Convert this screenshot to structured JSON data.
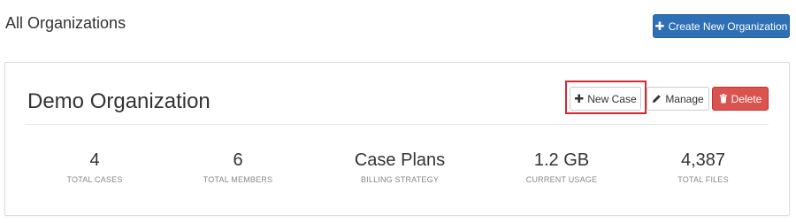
{
  "header": {
    "title": "All Organizations",
    "create_button": {
      "icon": "plus-icon",
      "label": "Create New Organization"
    }
  },
  "organization": {
    "name": "Demo Organization",
    "actions": {
      "new_case": {
        "icon": "plus-icon",
        "label": "New Case"
      },
      "manage": {
        "icon": "pencil-icon",
        "label": "Manage"
      },
      "delete": {
        "icon": "trash-icon",
        "label": "Delete"
      }
    },
    "stats": [
      {
        "value": "4",
        "label": "TOTAL CASES"
      },
      {
        "value": "6",
        "label": "TOTAL MEMBERS"
      },
      {
        "value": "Case Plans",
        "label": "BILLING STRATEGY"
      },
      {
        "value": "1.2 GB",
        "label": "CURRENT USAGE"
      },
      {
        "value": "4,387",
        "label": "TOTAL FILES"
      }
    ]
  },
  "colors": {
    "primary": "#2f6fb5",
    "danger": "#d9534f",
    "highlight": "#d9262f"
  }
}
